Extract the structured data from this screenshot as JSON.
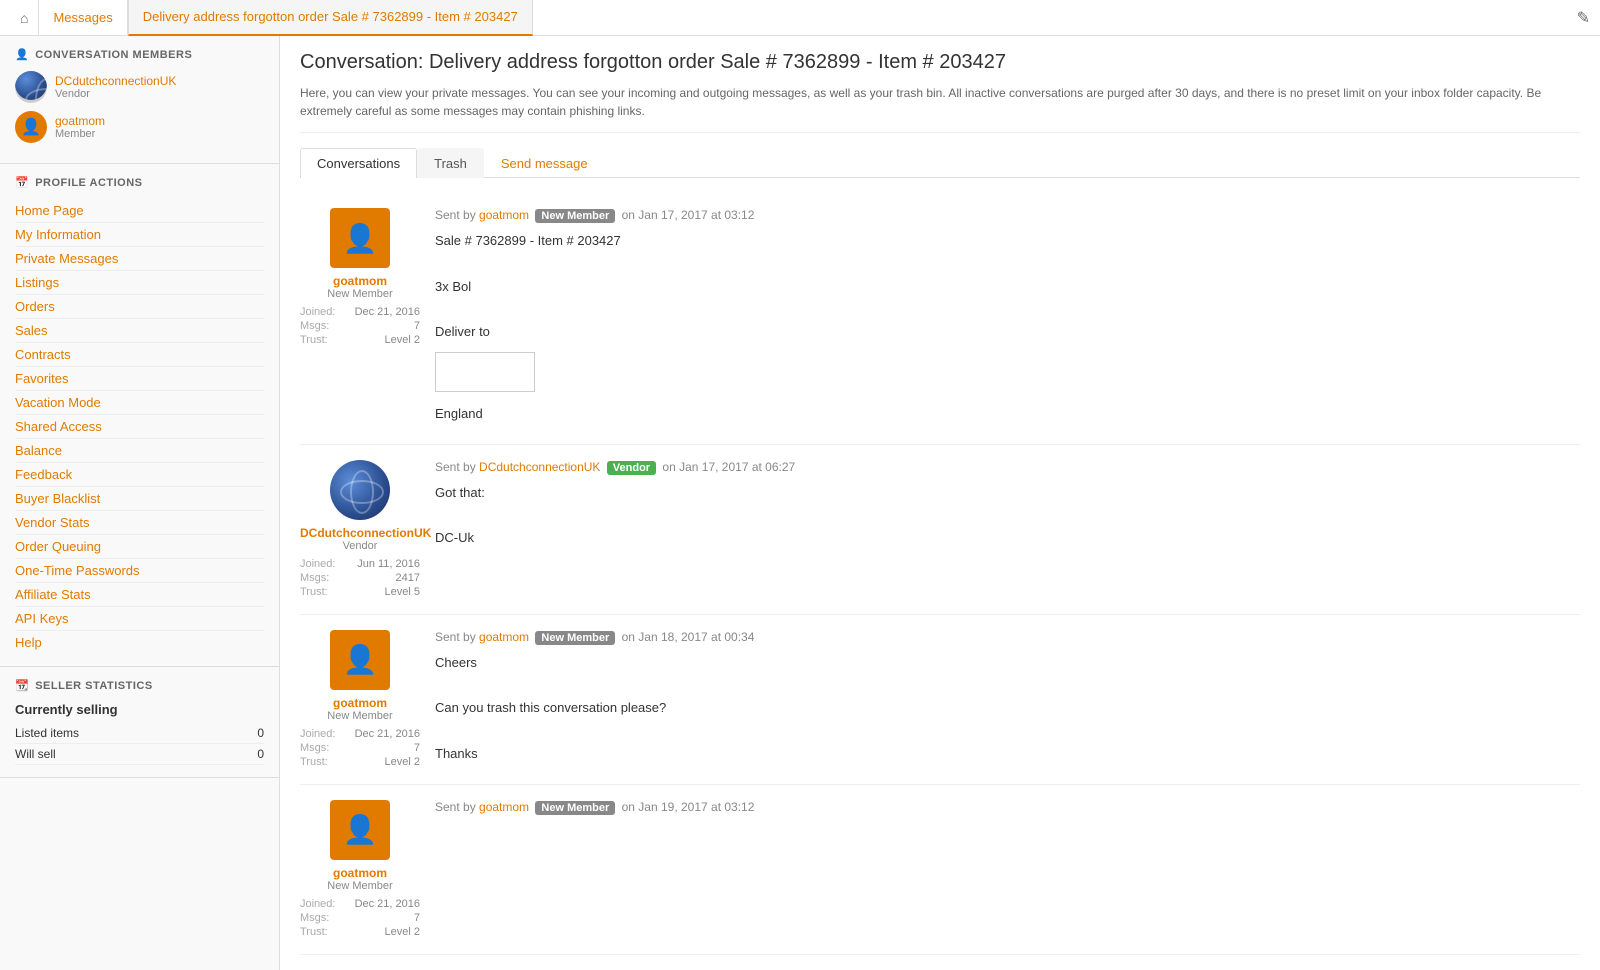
{
  "topnav": {
    "home_icon": "⌂",
    "tabs": [
      {
        "label": "Messages",
        "active": false
      },
      {
        "label": "Delivery address forgotton order Sale # 7362899 - Item # 203427",
        "active": true
      }
    ],
    "right_icon": "⚙"
  },
  "sidebar": {
    "conversation_members_title": "CONVERSATION MEMBERS",
    "members": [
      {
        "name": "DCdutchconnectionUK",
        "role": "Vendor",
        "type": "vendor"
      },
      {
        "name": "goatmom",
        "role": "Member",
        "type": "member"
      }
    ],
    "profile_actions_title": "PROFILE ACTIONS",
    "links": [
      "Home Page",
      "My Information",
      "Private Messages",
      "Listings",
      "Orders",
      "Sales",
      "Contracts",
      "Favorites",
      "Vacation Mode",
      "Shared Access",
      "Balance",
      "Feedback",
      "Buyer Blacklist",
      "Vendor Stats",
      "Order Queuing",
      "One-Time Passwords",
      "Affiliate Stats",
      "API Keys",
      "Help"
    ],
    "seller_stats_title": "SELLER STATISTICS",
    "currently_selling_label": "Currently selling",
    "stats": [
      {
        "label": "Listed items",
        "value": "0"
      },
      {
        "label": "Will sell",
        "value": "0"
      }
    ]
  },
  "main": {
    "page_title": "Conversation: Delivery address forgotton order Sale # 7362899 - Item # 203427",
    "info_text": "Here, you can view your private messages. You can see your incoming and outgoing messages, as well as your trash bin. All inactive conversations are purged after 30 days, and there is no preset limit on your inbox folder capacity. Be extremely careful as some messages may contain phishing links.",
    "tabs": [
      {
        "label": "Conversations",
        "active": true
      },
      {
        "label": "Trash",
        "active": false
      },
      {
        "label": "Send message",
        "active": false,
        "send": true
      }
    ],
    "messages": [
      {
        "sender_name": "goatmom",
        "sender_role": "New Member",
        "sender_type": "member",
        "joined": "Dec 21, 2016",
        "msgs": "7",
        "trust": "Level 2",
        "sent_by": "goatmom",
        "badge": "New Member",
        "badge_type": "new-member",
        "date": "on Jan 17, 2017 at 03:12",
        "body_lines": [
          "Sale # 7362899 - Item # 203427",
          "",
          "3x Bol",
          "",
          "Deliver to",
          "[ADDRESS BOX]",
          "England"
        ]
      },
      {
        "sender_name": "DCdutchconnectionUK",
        "sender_role": "Vendor",
        "sender_type": "vendor",
        "joined": "Jun 11, 2016",
        "msgs": "2417",
        "trust": "Level 5",
        "sent_by": "DCdutchconnectionUK",
        "badge": "Vendor",
        "badge_type": "vendor",
        "date": "on Jan 17, 2017 at 06:27",
        "body_lines": [
          "Got that:",
          "",
          "DC-Uk"
        ]
      },
      {
        "sender_name": "goatmom",
        "sender_role": "New Member",
        "sender_type": "member",
        "joined": "Dec 21, 2016",
        "msgs": "7",
        "trust": "Level 2",
        "sent_by": "goatmom",
        "badge": "New Member",
        "badge_type": "new-member",
        "date": "on Jan 18, 2017 at 00:34",
        "body_lines": [
          "Cheers",
          "",
          "Can you trash this conversation please?",
          "",
          "Thanks"
        ]
      },
      {
        "sender_name": "goatmom",
        "sender_role": "New Member",
        "sender_type": "member",
        "joined": "Dec 21, 2016",
        "msgs": "7",
        "trust": "Level 2",
        "sent_by": "goatmom",
        "badge": "New Member",
        "badge_type": "new-member",
        "date": "on Jan 19, 2017 at 03:12",
        "body_lines": []
      }
    ]
  }
}
